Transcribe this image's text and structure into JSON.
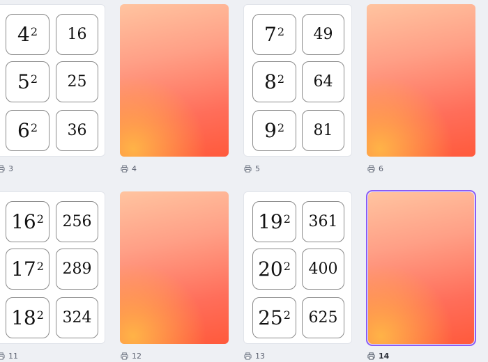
{
  "pages": [
    {
      "number": "3",
      "type": "cards",
      "cards": [
        {
          "base": "4",
          "exp": "2",
          "answer": "16"
        },
        {
          "base": "5",
          "exp": "2",
          "answer": "25"
        },
        {
          "base": "6",
          "exp": "2",
          "answer": "36"
        }
      ]
    },
    {
      "number": "4",
      "type": "gradient"
    },
    {
      "number": "5",
      "type": "cards",
      "cards": [
        {
          "base": "7",
          "exp": "2",
          "answer": "49"
        },
        {
          "base": "8",
          "exp": "2",
          "answer": "64"
        },
        {
          "base": "9",
          "exp": "2",
          "answer": "81"
        }
      ]
    },
    {
      "number": "6",
      "type": "gradient"
    },
    {
      "number": "11",
      "type": "cards",
      "cards": [
        {
          "base": "16",
          "exp": "2",
          "answer": "256"
        },
        {
          "base": "17",
          "exp": "2",
          "answer": "289"
        },
        {
          "base": "18",
          "exp": "2",
          "answer": "324"
        }
      ]
    },
    {
      "number": "12",
      "type": "gradient"
    },
    {
      "number": "13",
      "type": "cards",
      "cards": [
        {
          "base": "19",
          "exp": "2",
          "answer": "361"
        },
        {
          "base": "20",
          "exp": "2",
          "answer": "400"
        },
        {
          "base": "25",
          "exp": "2",
          "answer": "625"
        }
      ]
    },
    {
      "number": "14",
      "type": "gradient",
      "selected": true
    }
  ],
  "colors": {
    "selection": "#8b5cf6",
    "gradient_top": "#ffc4a0",
    "gradient_bottom": "#ff5a3c"
  },
  "icons": {
    "page_caption": "printer-icon"
  }
}
